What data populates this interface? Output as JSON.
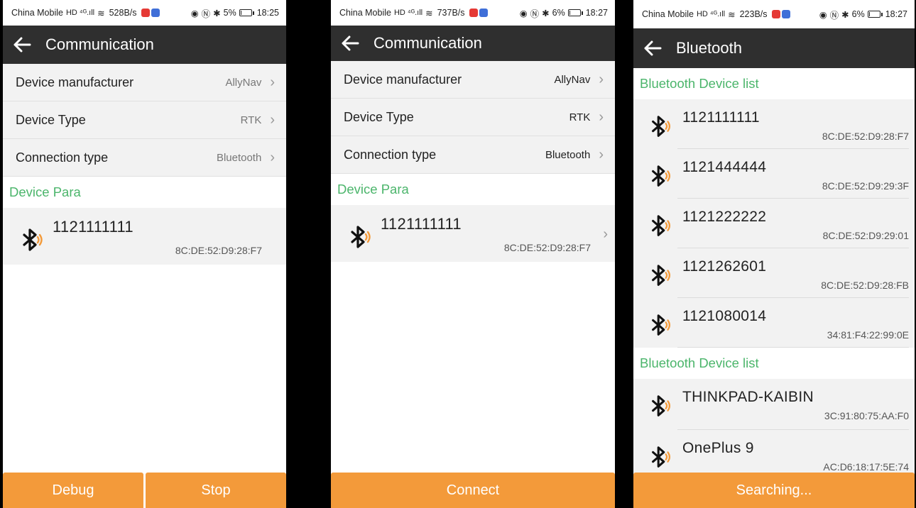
{
  "status": {
    "carrier": "China Mobile",
    "signal": "HD ⁴ᴳ.ıll",
    "screens": [
      {
        "speed": "528B/s",
        "battery": "5%",
        "time": "18:25",
        "battery_level": 0.05
      },
      {
        "speed": "737B/s",
        "battery": "6%",
        "time": "18:27",
        "battery_level": 0.06
      },
      {
        "speed": "223B/s",
        "battery": "6%",
        "time": "18:27",
        "battery_level": 0.06
      }
    ]
  },
  "communication": {
    "title": "Communication",
    "rows": [
      {
        "label": "Device manufacturer",
        "value": "AllyNav"
      },
      {
        "label": "Device Type",
        "value": "RTK"
      },
      {
        "label": "Connection type",
        "value": "Bluetooth"
      }
    ],
    "section": "Device Para",
    "device": {
      "name": "1121111111",
      "mac": "8C:DE:52:D9:28:F7"
    }
  },
  "screen1": {
    "buttons": [
      "Debug",
      "Stop"
    ]
  },
  "screen2": {
    "button": "Connect"
  },
  "bluetooth": {
    "title": "Bluetooth",
    "lists": [
      {
        "section": "Bluetooth Device list",
        "devices": [
          {
            "name": "1121111111",
            "mac": "8C:DE:52:D9:28:F7"
          },
          {
            "name": "1121444444",
            "mac": "8C:DE:52:D9:29:3F"
          },
          {
            "name": "1121222222",
            "mac": "8C:DE:52:D9:29:01"
          },
          {
            "name": "1121262601",
            "mac": "8C:DE:52:D9:28:FB"
          },
          {
            "name": "1121080014",
            "mac": "34:81:F4:22:99:0E"
          }
        ]
      },
      {
        "section": "Bluetooth Device list",
        "devices": [
          {
            "name": "THINKPAD-KAIBIN",
            "mac": "3C:91:80:75:AA:F0"
          },
          {
            "name": "OnePlus 9",
            "mac": "AC:D6:18:17:5E:74"
          }
        ]
      }
    ],
    "button": "Searching..."
  },
  "colors": {
    "accent_green": "#4bb56b",
    "button_orange": "#f39a3a",
    "appbar": "#2f2f2f",
    "bt_wave": "#f39a3a"
  },
  "icons": {
    "back": "arrow-left-icon",
    "bluetooth": "bluetooth-signal-icon",
    "chevron": "chevron-right-icon"
  }
}
